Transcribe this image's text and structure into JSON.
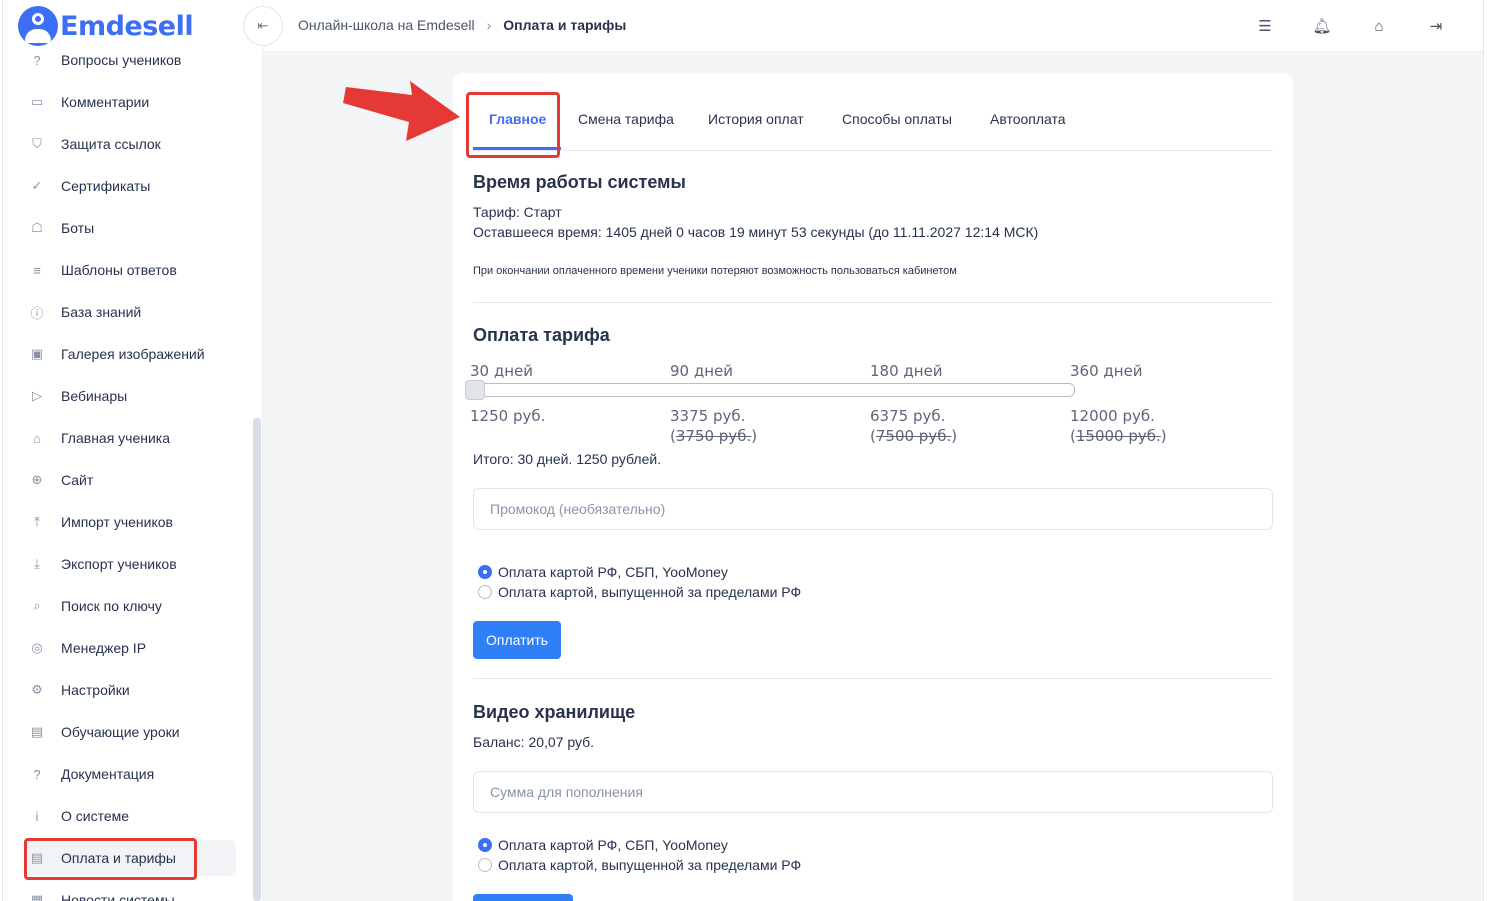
{
  "brand": {
    "name": "Emdesell"
  },
  "sidebar": {
    "items": [
      {
        "label": "Вопросы учеников",
        "icon": "question-circle-icon",
        "glyph": "?"
      },
      {
        "label": "Комментарии",
        "icon": "comment-icon",
        "glyph": "▭"
      },
      {
        "label": "Защита ссылок",
        "icon": "shield-icon",
        "glyph": "⛉"
      },
      {
        "label": "Сертификаты",
        "icon": "certificate-icon",
        "glyph": "✓"
      },
      {
        "label": "Боты",
        "icon": "robot-icon",
        "glyph": "☖"
      },
      {
        "label": "Шаблоны ответов",
        "icon": "list-icon",
        "glyph": "≡"
      },
      {
        "label": "База знаний",
        "icon": "info-circle-icon",
        "glyph": "ⓘ"
      },
      {
        "label": "Галерея изображений",
        "icon": "image-icon",
        "glyph": "▣"
      },
      {
        "label": "Вебинары",
        "icon": "play-icon",
        "glyph": "▷"
      },
      {
        "label": "Главная ученика",
        "icon": "home-icon",
        "glyph": "⌂"
      },
      {
        "label": "Сайт",
        "icon": "globe-icon",
        "glyph": "⊕"
      },
      {
        "label": "Импорт учеников",
        "icon": "upload-icon",
        "glyph": "⤒"
      },
      {
        "label": "Экспорт учеников",
        "icon": "download-icon",
        "glyph": "⤓"
      },
      {
        "label": "Поиск по ключу",
        "icon": "search-icon",
        "glyph": "⌕"
      },
      {
        "label": "Менеджер IP",
        "icon": "target-icon",
        "glyph": "◎"
      },
      {
        "label": "Настройки",
        "icon": "gear-icon",
        "glyph": "⚙"
      },
      {
        "label": "Обучающие уроки",
        "icon": "film-icon",
        "glyph": "▤"
      },
      {
        "label": "Документация",
        "icon": "question-square-icon",
        "glyph": "?"
      },
      {
        "label": "О системе",
        "icon": "info-square-icon",
        "glyph": "i"
      },
      {
        "label": "Оплата и тарифы",
        "icon": "document-icon",
        "glyph": "▤"
      },
      {
        "label": "Новости системы",
        "icon": "news-icon",
        "glyph": "▦"
      }
    ]
  },
  "header": {
    "breadcrumb": [
      "Онлайн-школа на Emdesell",
      "Оплата и тарифы"
    ]
  },
  "tabs": [
    "Главное",
    "Смена тарифа",
    "История оплат",
    "Способы оплаты",
    "Автооплата"
  ],
  "system_time": {
    "title": "Время работы системы",
    "tariff": "Тариф: Старт",
    "remaining": "Оставшееся время: 1405 дней 0 часов 19 минут 53 секунды (до 11.11.2027 12:14 МСК)",
    "note": "При окончании оплаченного времени ученики потеряют возможность пользоваться кабинетом"
  },
  "tariff_payment": {
    "title": "Оплата тарифа",
    "periods": [
      {
        "label": "30 дней",
        "price": "1250 руб.",
        "old_price": ""
      },
      {
        "label": "90 дней",
        "price": "3375 руб.",
        "old_price": "3750 руб."
      },
      {
        "label": "180 дней",
        "price": "6375 руб.",
        "old_price": "7500 руб."
      },
      {
        "label": "360 дней",
        "price": "12000 руб.",
        "old_price": "15000 руб."
      }
    ],
    "selected_index": 0,
    "total": "Итого: 30 дней. 1250 рублей.",
    "promo_placeholder": "Промокод (необязательно)",
    "methods": [
      "Оплата картой РФ, СБП, YooMoney",
      "Оплата картой, выпущенной за пределами РФ"
    ],
    "selected_method": 0,
    "pay_button": "Оплатить"
  },
  "video_storage": {
    "title": "Видео хранилище",
    "balance": "Баланс: 20,07 руб.",
    "amount_placeholder": "Сумма для пополнения",
    "methods": [
      "Оплата картой РФ, СБП, YooMoney",
      "Оплата картой, выпущенной за пределами РФ"
    ],
    "selected_method": 0
  },
  "colors": {
    "accent": "#3d6ff5",
    "button": "#2f80f7",
    "annotation": "#e53935"
  }
}
